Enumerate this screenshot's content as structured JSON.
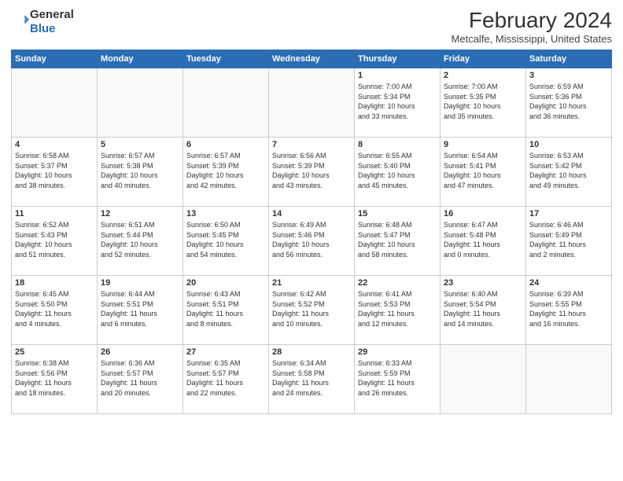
{
  "header": {
    "logo_line1": "General",
    "logo_line2": "Blue",
    "month_title": "February 2024",
    "location": "Metcalfe, Mississippi, United States"
  },
  "weekdays": [
    "Sunday",
    "Monday",
    "Tuesday",
    "Wednesday",
    "Thursday",
    "Friday",
    "Saturday"
  ],
  "weeks": [
    [
      {
        "day": "",
        "info": ""
      },
      {
        "day": "",
        "info": ""
      },
      {
        "day": "",
        "info": ""
      },
      {
        "day": "",
        "info": ""
      },
      {
        "day": "1",
        "info": "Sunrise: 7:00 AM\nSunset: 5:34 PM\nDaylight: 10 hours\nand 33 minutes."
      },
      {
        "day": "2",
        "info": "Sunrise: 7:00 AM\nSunset: 5:35 PM\nDaylight: 10 hours\nand 35 minutes."
      },
      {
        "day": "3",
        "info": "Sunrise: 6:59 AM\nSunset: 5:36 PM\nDaylight: 10 hours\nand 36 minutes."
      }
    ],
    [
      {
        "day": "4",
        "info": "Sunrise: 6:58 AM\nSunset: 5:37 PM\nDaylight: 10 hours\nand 38 minutes."
      },
      {
        "day": "5",
        "info": "Sunrise: 6:57 AM\nSunset: 5:38 PM\nDaylight: 10 hours\nand 40 minutes."
      },
      {
        "day": "6",
        "info": "Sunrise: 6:57 AM\nSunset: 5:39 PM\nDaylight: 10 hours\nand 42 minutes."
      },
      {
        "day": "7",
        "info": "Sunrise: 6:56 AM\nSunset: 5:39 PM\nDaylight: 10 hours\nand 43 minutes."
      },
      {
        "day": "8",
        "info": "Sunrise: 6:55 AM\nSunset: 5:40 PM\nDaylight: 10 hours\nand 45 minutes."
      },
      {
        "day": "9",
        "info": "Sunrise: 6:54 AM\nSunset: 5:41 PM\nDaylight: 10 hours\nand 47 minutes."
      },
      {
        "day": "10",
        "info": "Sunrise: 6:53 AM\nSunset: 5:42 PM\nDaylight: 10 hours\nand 49 minutes."
      }
    ],
    [
      {
        "day": "11",
        "info": "Sunrise: 6:52 AM\nSunset: 5:43 PM\nDaylight: 10 hours\nand 51 minutes."
      },
      {
        "day": "12",
        "info": "Sunrise: 6:51 AM\nSunset: 5:44 PM\nDaylight: 10 hours\nand 52 minutes."
      },
      {
        "day": "13",
        "info": "Sunrise: 6:50 AM\nSunset: 5:45 PM\nDaylight: 10 hours\nand 54 minutes."
      },
      {
        "day": "14",
        "info": "Sunrise: 6:49 AM\nSunset: 5:46 PM\nDaylight: 10 hours\nand 56 minutes."
      },
      {
        "day": "15",
        "info": "Sunrise: 6:48 AM\nSunset: 5:47 PM\nDaylight: 10 hours\nand 58 minutes."
      },
      {
        "day": "16",
        "info": "Sunrise: 6:47 AM\nSunset: 5:48 PM\nDaylight: 11 hours\nand 0 minutes."
      },
      {
        "day": "17",
        "info": "Sunrise: 6:46 AM\nSunset: 5:49 PM\nDaylight: 11 hours\nand 2 minutes."
      }
    ],
    [
      {
        "day": "18",
        "info": "Sunrise: 6:45 AM\nSunset: 5:50 PM\nDaylight: 11 hours\nand 4 minutes."
      },
      {
        "day": "19",
        "info": "Sunrise: 6:44 AM\nSunset: 5:51 PM\nDaylight: 11 hours\nand 6 minutes."
      },
      {
        "day": "20",
        "info": "Sunrise: 6:43 AM\nSunset: 5:51 PM\nDaylight: 11 hours\nand 8 minutes."
      },
      {
        "day": "21",
        "info": "Sunrise: 6:42 AM\nSunset: 5:52 PM\nDaylight: 11 hours\nand 10 minutes."
      },
      {
        "day": "22",
        "info": "Sunrise: 6:41 AM\nSunset: 5:53 PM\nDaylight: 11 hours\nand 12 minutes."
      },
      {
        "day": "23",
        "info": "Sunrise: 6:40 AM\nSunset: 5:54 PM\nDaylight: 11 hours\nand 14 minutes."
      },
      {
        "day": "24",
        "info": "Sunrise: 6:39 AM\nSunset: 5:55 PM\nDaylight: 11 hours\nand 16 minutes."
      }
    ],
    [
      {
        "day": "25",
        "info": "Sunrise: 6:38 AM\nSunset: 5:56 PM\nDaylight: 11 hours\nand 18 minutes."
      },
      {
        "day": "26",
        "info": "Sunrise: 6:36 AM\nSunset: 5:57 PM\nDaylight: 11 hours\nand 20 minutes."
      },
      {
        "day": "27",
        "info": "Sunrise: 6:35 AM\nSunset: 5:57 PM\nDaylight: 11 hours\nand 22 minutes."
      },
      {
        "day": "28",
        "info": "Sunrise: 6:34 AM\nSunset: 5:58 PM\nDaylight: 11 hours\nand 24 minutes."
      },
      {
        "day": "29",
        "info": "Sunrise: 6:33 AM\nSunset: 5:59 PM\nDaylight: 11 hours\nand 26 minutes."
      },
      {
        "day": "",
        "info": ""
      },
      {
        "day": "",
        "info": ""
      }
    ]
  ]
}
